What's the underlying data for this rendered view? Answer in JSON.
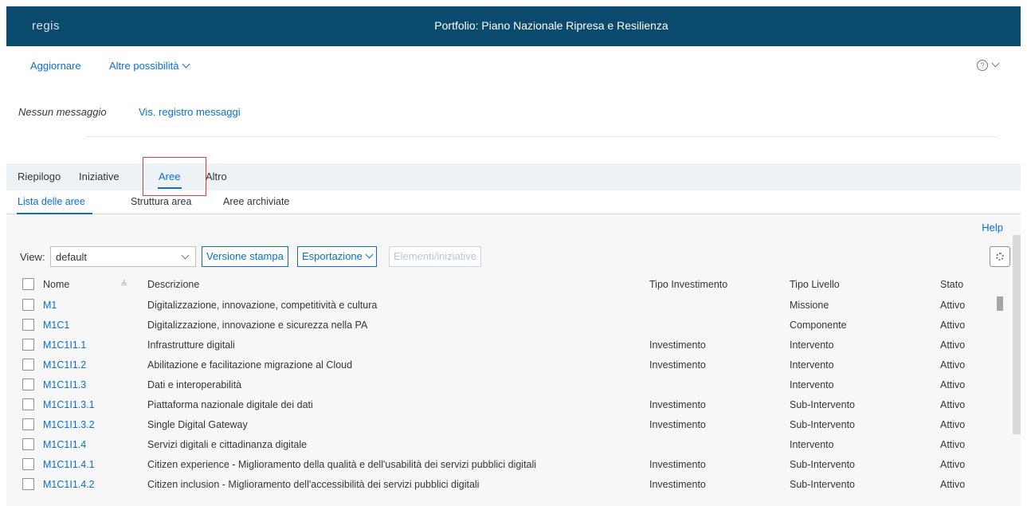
{
  "header": {
    "logo": "regis",
    "title": "Portfolio: Piano Nazionale Ripresa e Resilienza"
  },
  "toolbar": {
    "refresh": "Aggiornare",
    "more": "Altre possibilità",
    "help_icon": "question-icon"
  },
  "messages": {
    "none": "Nessun messaggio",
    "log": "Vis. registro messaggi"
  },
  "tabs": [
    {
      "label": "Riepilogo",
      "selected": false
    },
    {
      "label": "Iniziative",
      "selected": false
    },
    {
      "label": "Aree",
      "selected": true
    },
    {
      "label": "Altro",
      "selected": false
    }
  ],
  "subtabs": [
    {
      "label": "Lista delle aree",
      "selected": true
    },
    {
      "label": "Struttura area",
      "selected": false
    },
    {
      "label": "Aree archiviate",
      "selected": false
    }
  ],
  "content": {
    "help": "Help",
    "view_label": "View:",
    "view_value": "default",
    "buttons": {
      "print": "Versione stampa",
      "export": "Esportazione",
      "elements": "Elementi/iniziative"
    }
  },
  "table": {
    "columns": {
      "name": "Nome",
      "desc": "Descrizione",
      "inv": "Tipo Investimento",
      "level": "Tipo Livello",
      "status": "Stato"
    },
    "rows": [
      {
        "name": "M1",
        "desc": "Digitalizzazione, innovazione, competitività e cultura",
        "inv": "",
        "level": "Missione",
        "status": "Attivo"
      },
      {
        "name": "M1C1",
        "desc": "Digitalizzazione, innovazione e sicurezza nella PA",
        "inv": "",
        "level": "Componente",
        "status": "Attivo"
      },
      {
        "name": "M1C1I1.1",
        "desc": "Infrastrutture digitali",
        "inv": "Investimento",
        "level": "Intervento",
        "status": "Attivo"
      },
      {
        "name": "M1C1I1.2",
        "desc": "Abilitazione e facilitazione migrazione al Cloud",
        "inv": "Investimento",
        "level": "Intervento",
        "status": "Attivo"
      },
      {
        "name": "M1C1I1.3",
        "desc": "Dati e interoperabilità",
        "inv": "",
        "level": "Intervento",
        "status": "Attivo"
      },
      {
        "name": "M1C1I1.3.1",
        "desc": "Piattaforma nazionale digitale dei dati",
        "inv": "Investimento",
        "level": "Sub-Intervento",
        "status": "Attivo"
      },
      {
        "name": "M1C1I1.3.2",
        "desc": " Single Digital Gateway",
        "inv": "Investimento",
        "level": "Sub-Intervento",
        "status": "Attivo"
      },
      {
        "name": "M1C1I1.4",
        "desc": "Servizi digitali e cittadinanza digitale",
        "inv": "",
        "level": "Intervento",
        "status": "Attivo"
      },
      {
        "name": "M1C1I1.4.1",
        "desc": "Citizen experience - Miglioramento della qualità e dell'usabilità dei servizi pubblici digitali",
        "inv": "Investimento",
        "level": "Sub-Intervento",
        "status": "Attivo"
      },
      {
        "name": "M1C1I1.4.2",
        "desc": "Citizen inclusion - Miglioramento dell'accessibilità dei servizi pubblici digitali",
        "inv": "Investimento",
        "level": "Sub-Intervento",
        "status": "Attivo"
      }
    ]
  },
  "colors": {
    "brand": "#0a4a6e",
    "accent": "#0a6ed1",
    "highlight": "#e23b3b"
  }
}
